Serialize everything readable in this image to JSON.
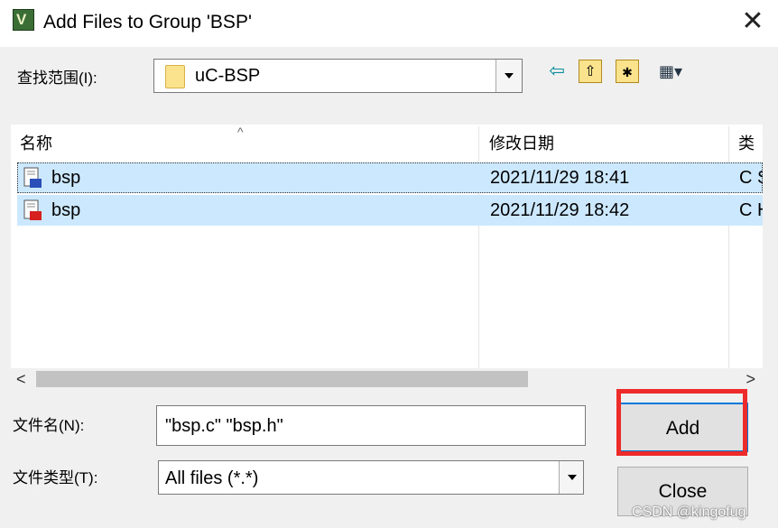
{
  "window": {
    "title": "Add Files to Group 'BSP'",
    "app_icon_text": "V",
    "close_glyph": "✕"
  },
  "lookin": {
    "label": "查找范围(I):",
    "value": "uC-BSP"
  },
  "toolbar": {
    "back_icon": "⇦",
    "up_icon": "⇧",
    "new_folder_icon": "✱",
    "view_menu_icon": "▦▾"
  },
  "list": {
    "sort_glyph": "^",
    "columns": [
      "名称",
      "修改日期",
      "类"
    ],
    "rows": [
      {
        "name": "bsp",
        "date": "2021/11/29 18:41",
        "type": "C S",
        "icon": "c-source-file-icon",
        "icon_color": "#2b4fb8"
      },
      {
        "name": "bsp",
        "date": "2021/11/29 18:42",
        "type": "C H",
        "icon": "c-header-file-icon",
        "icon_color": "#d62020"
      }
    ]
  },
  "scrollbar": {
    "left_glyph": "<",
    "right_glyph": ">"
  },
  "filename": {
    "label": "文件名(N):",
    "value": "\"bsp.c\" \"bsp.h\""
  },
  "filetype": {
    "label": "文件类型(T):",
    "value": "All files (*.*)"
  },
  "buttons": {
    "add": "Add",
    "close": "Close"
  },
  "highlight_color": "#ee2b2b",
  "watermark": "CSDN @kingofug"
}
